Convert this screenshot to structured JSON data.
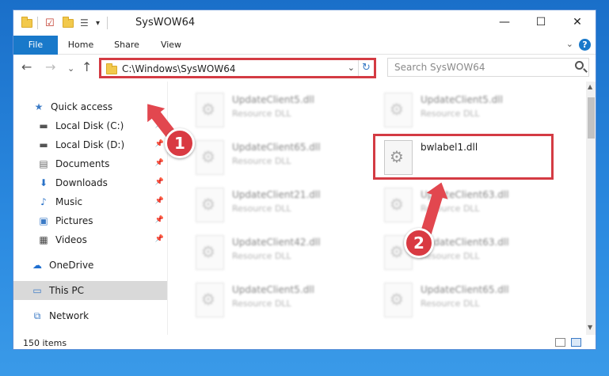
{
  "window": {
    "title": "SysWOW64",
    "controls": {
      "minimize": "—",
      "maximize": "☐",
      "close": "✕"
    }
  },
  "ribbon": {
    "tabs": [
      "File",
      "Home",
      "Share",
      "View"
    ],
    "help": "?",
    "collapse": "⌄"
  },
  "nav": {
    "back": "←",
    "forward": "→",
    "recent": "⌄",
    "up": "↑",
    "address": "C:\\Windows\\SysWOW64",
    "address_dropdown": "⌄",
    "refresh": "↻",
    "search_placeholder": "Search SysWOW64"
  },
  "sidebar": {
    "items": [
      {
        "label": "Quick access",
        "icon": "star-icon",
        "glyph": "★",
        "color": "#3c7bc6",
        "pinned": false
      },
      {
        "label": "Local Disk (C:)",
        "icon": "drive-icon",
        "glyph": "▬",
        "color": "#555555",
        "pinned": true
      },
      {
        "label": "Local Disk (D:)",
        "icon": "drive-icon",
        "glyph": "▬",
        "color": "#555555",
        "pinned": true
      },
      {
        "label": "Documents",
        "icon": "documents-icon",
        "glyph": "▤",
        "color": "#6a6a6a",
        "pinned": true
      },
      {
        "label": "Downloads",
        "icon": "download-icon",
        "glyph": "⬇",
        "color": "#2a72c8",
        "pinned": true
      },
      {
        "label": "Music",
        "icon": "music-icon",
        "glyph": "♪",
        "color": "#2a72c8",
        "pinned": true
      },
      {
        "label": "Pictures",
        "icon": "pictures-icon",
        "glyph": "▣",
        "color": "#3c7bc6",
        "pinned": true
      },
      {
        "label": "Videos",
        "icon": "videos-icon",
        "glyph": "▦",
        "color": "#444444",
        "pinned": true
      },
      {
        "label": "OneDrive",
        "icon": "cloud-icon",
        "glyph": "☁",
        "color": "#1f6fd0",
        "pinned": false
      },
      {
        "label": "This PC",
        "icon": "computer-icon",
        "glyph": "▭",
        "color": "#3c7bc6",
        "pinned": false
      },
      {
        "label": "Network",
        "icon": "network-icon",
        "glyph": "⧉",
        "color": "#3c7bc6",
        "pinned": false
      }
    ],
    "pin_glyph": "📌"
  },
  "files": [
    {
      "name": "UpdateClient5.dll",
      "type": "Resource DLL",
      "focus": false
    },
    {
      "name": "UpdateClient5.dll",
      "type": "Resource DLL",
      "focus": false
    },
    {
      "name": "UpdateClient65.dll",
      "type": "Resource DLL",
      "focus": false
    },
    {
      "name": "bwlabel1.dll",
      "type": "",
      "focus": true
    },
    {
      "name": "UpdateClient21.dll",
      "type": "Resource DLL",
      "focus": false
    },
    {
      "name": "UpdateClient63.dll",
      "type": "Resource DLL",
      "focus": false
    },
    {
      "name": "UpdateClient42.dll",
      "type": "Resource DLL",
      "focus": false
    },
    {
      "name": "UpdateClient63.dll",
      "type": "Resource DLL",
      "focus": false
    },
    {
      "name": "UpdateClient5.dll",
      "type": "Resource DLL",
      "focus": false
    },
    {
      "name": "UpdateClient65.dll",
      "type": "Resource DLL",
      "focus": false
    }
  ],
  "status": {
    "item_count": "150 items"
  },
  "annotations": {
    "badge1": "1",
    "badge2": "2",
    "color": "#d93a42"
  }
}
